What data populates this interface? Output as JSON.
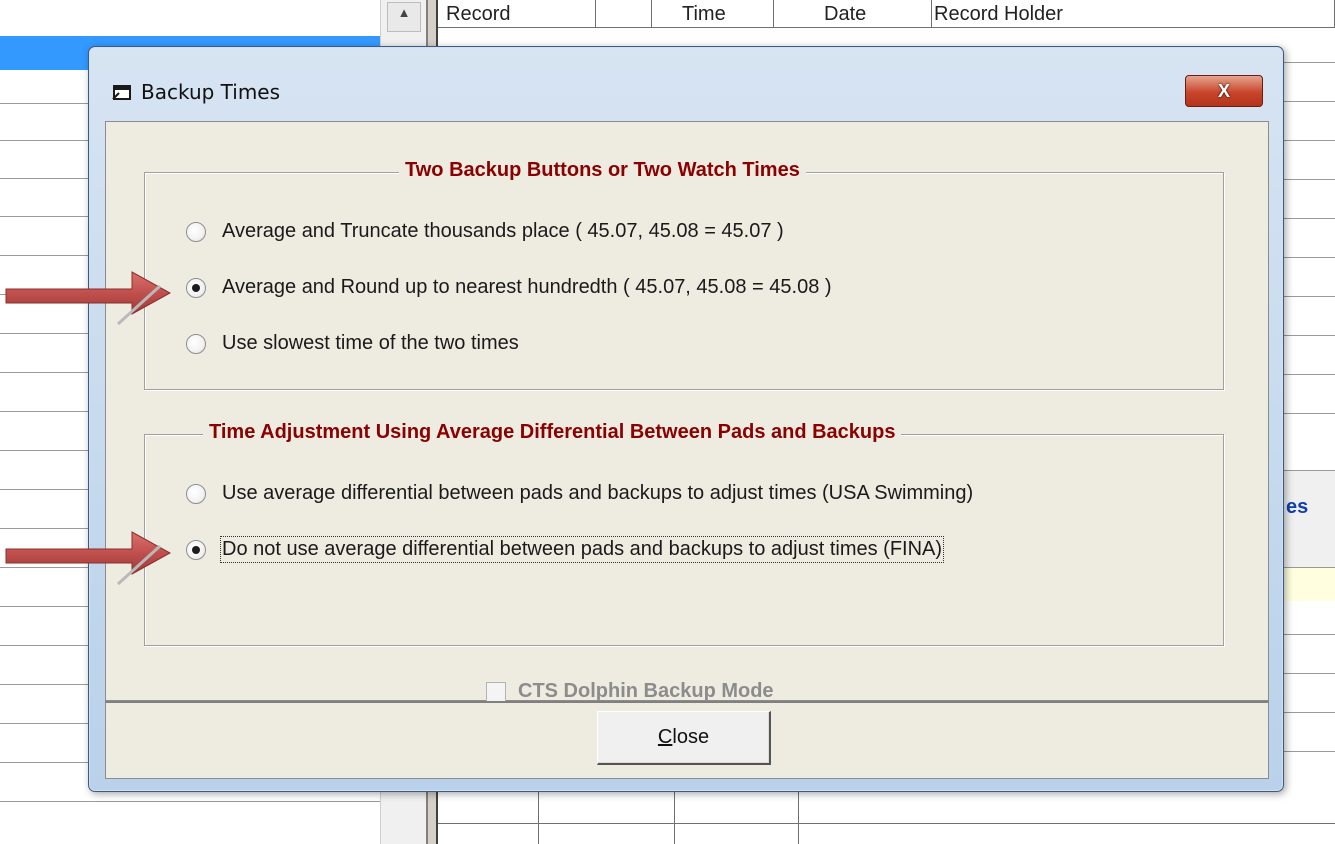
{
  "background": {
    "grid_headers": [
      "Record",
      "",
      "Time",
      "Date",
      "Record Holder"
    ],
    "partial_label": "es"
  },
  "dialog": {
    "title": "Backup Times",
    "title_close_glyph": "X",
    "group1": {
      "title": "Two Backup Buttons or Two Watch Times",
      "options": [
        {
          "label": "Average and Truncate thousands place  ( 45.07, 45.08 = 45.07 )",
          "checked": false
        },
        {
          "label": "Average and Round up to nearest hundredth  ( 45.07, 45.08 = 45.08 )",
          "checked": true
        },
        {
          "label": "Use slowest time of the two times",
          "checked": false
        }
      ]
    },
    "group2": {
      "title": "Time Adjustment Using Average Differential Between Pads and Backups",
      "options": [
        {
          "label": "Use average differential between pads and backups to adjust times (USA Swimming)",
          "checked": false
        },
        {
          "label": "Do not use average differential between pads and backups to adjust times (FINA)",
          "checked": true
        }
      ]
    },
    "checkbox_label": "CTS Dolphin Backup Mode",
    "checkbox_checked": false,
    "checkbox_enabled": false,
    "close_button": {
      "prefix": "C",
      "rest": "lose"
    }
  },
  "icons": {
    "title_icon": "window-icon",
    "arrow_color": "#c0504d"
  },
  "colors": {
    "group_title": "#8b0000",
    "selection": "#3399ff",
    "close_x": "#c8452b"
  }
}
